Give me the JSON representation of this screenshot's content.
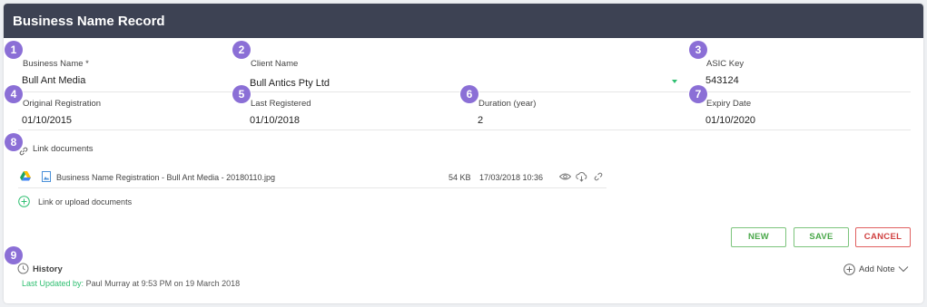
{
  "header": {
    "title": "Business Name Record"
  },
  "badges": [
    "1",
    "2",
    "3",
    "4",
    "5",
    "6",
    "7",
    "8",
    "9"
  ],
  "fields": {
    "business_name": {
      "label": "Business Name *",
      "value": "Bull Ant Media"
    },
    "client_name": {
      "label": "Client Name",
      "value": "Bull Antics Pty Ltd"
    },
    "asic_key": {
      "label": "ASIC Key",
      "value": "543124"
    },
    "original_registration": {
      "label": "Original Registration",
      "value": "01/10/2015"
    },
    "last_registered": {
      "label": "Last Registered",
      "value": "01/10/2018"
    },
    "duration": {
      "label": "Duration (year)",
      "value": "2"
    },
    "expiry_date": {
      "label": "Expiry Date",
      "value": "01/10/2020"
    }
  },
  "documents": {
    "section_label": "Link documents",
    "file": {
      "name": "Business Name Registration - Bull Ant Media - 20180110.jpg",
      "size": "54 KB",
      "date": "17/03/2018 10:36"
    },
    "link_upload_label": "Link or upload documents"
  },
  "buttons": {
    "new": "NEW",
    "save": "SAVE",
    "cancel": "CANCEL"
  },
  "history": {
    "title": "History",
    "updated_prefix": "Last Updated by:",
    "updated_text": "Paul Murray at 9:53 PM on 19 March 2018",
    "add_note": "Add Note"
  },
  "colors": {
    "header_bg": "#3d4253",
    "badge": "#8b6fd6",
    "accent_green": "#2fbf71",
    "cancel_red": "#d04040"
  }
}
